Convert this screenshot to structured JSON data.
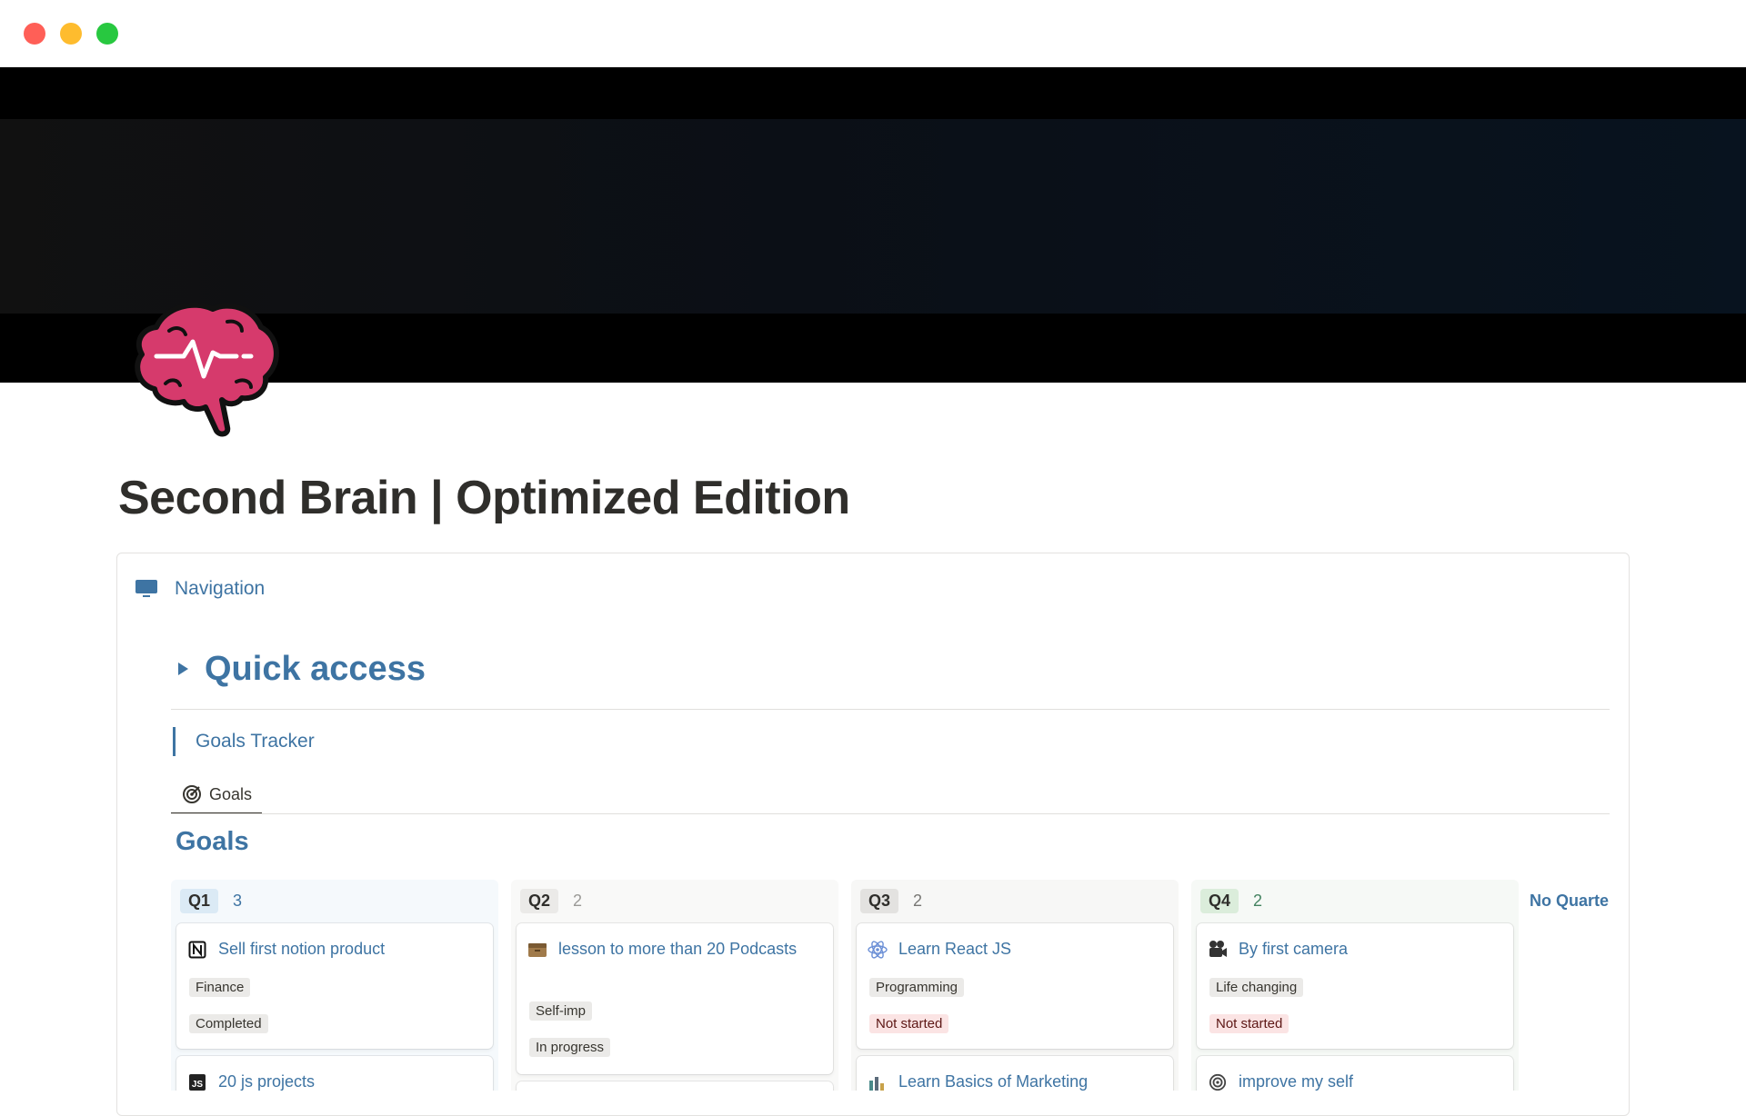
{
  "page": {
    "title": "Second Brain | Optimized Edition"
  },
  "navigation": {
    "label": "Navigation"
  },
  "quick_access": {
    "title": "Quick access"
  },
  "goals_tracker": {
    "label": "Goals Tracker",
    "view_tab": "Goals",
    "heading": "Goals"
  },
  "board": {
    "columns": [
      {
        "label": "Q1",
        "count": "3",
        "color": "#dbeaf5",
        "cards": [
          {
            "title": "Sell first notion product",
            "icon": "notion-icon",
            "tags": [
              "Finance",
              "Completed"
            ]
          },
          {
            "title": "20 js projects",
            "icon": "javascript-icon",
            "tags": []
          }
        ]
      },
      {
        "label": "Q2",
        "count": "2",
        "color": "#ebeae8",
        "cards": [
          {
            "title": "lesson to more than 20 Podcasts",
            "icon": "box-icon",
            "tags": [
              "Self-imp",
              "In progress"
            ]
          }
        ]
      },
      {
        "label": "Q3",
        "count": "2",
        "color": "#e3e2e0",
        "cards": [
          {
            "title": "Learn React JS",
            "icon": "react-icon",
            "tags": [
              "Programming",
              "Not started"
            ]
          },
          {
            "title": "Learn Basics of Marketing",
            "icon": "marketing-icon",
            "tags": []
          }
        ]
      },
      {
        "label": "Q4",
        "count": "2",
        "color": "#dbeddb",
        "cards": [
          {
            "title": "By first camera",
            "icon": "movie-camera-icon",
            "tags": [
              "Life changing",
              "Not started"
            ]
          },
          {
            "title": "improve my self",
            "icon": "target-icon",
            "tags": []
          }
        ]
      }
    ],
    "no_quarter": {
      "label": "No Quarter",
      "icon": "inbox-icon"
    }
  },
  "colors": {
    "accent": "#3e74a3",
    "title": "#2f2e2b",
    "brain": "#d63a6c"
  }
}
